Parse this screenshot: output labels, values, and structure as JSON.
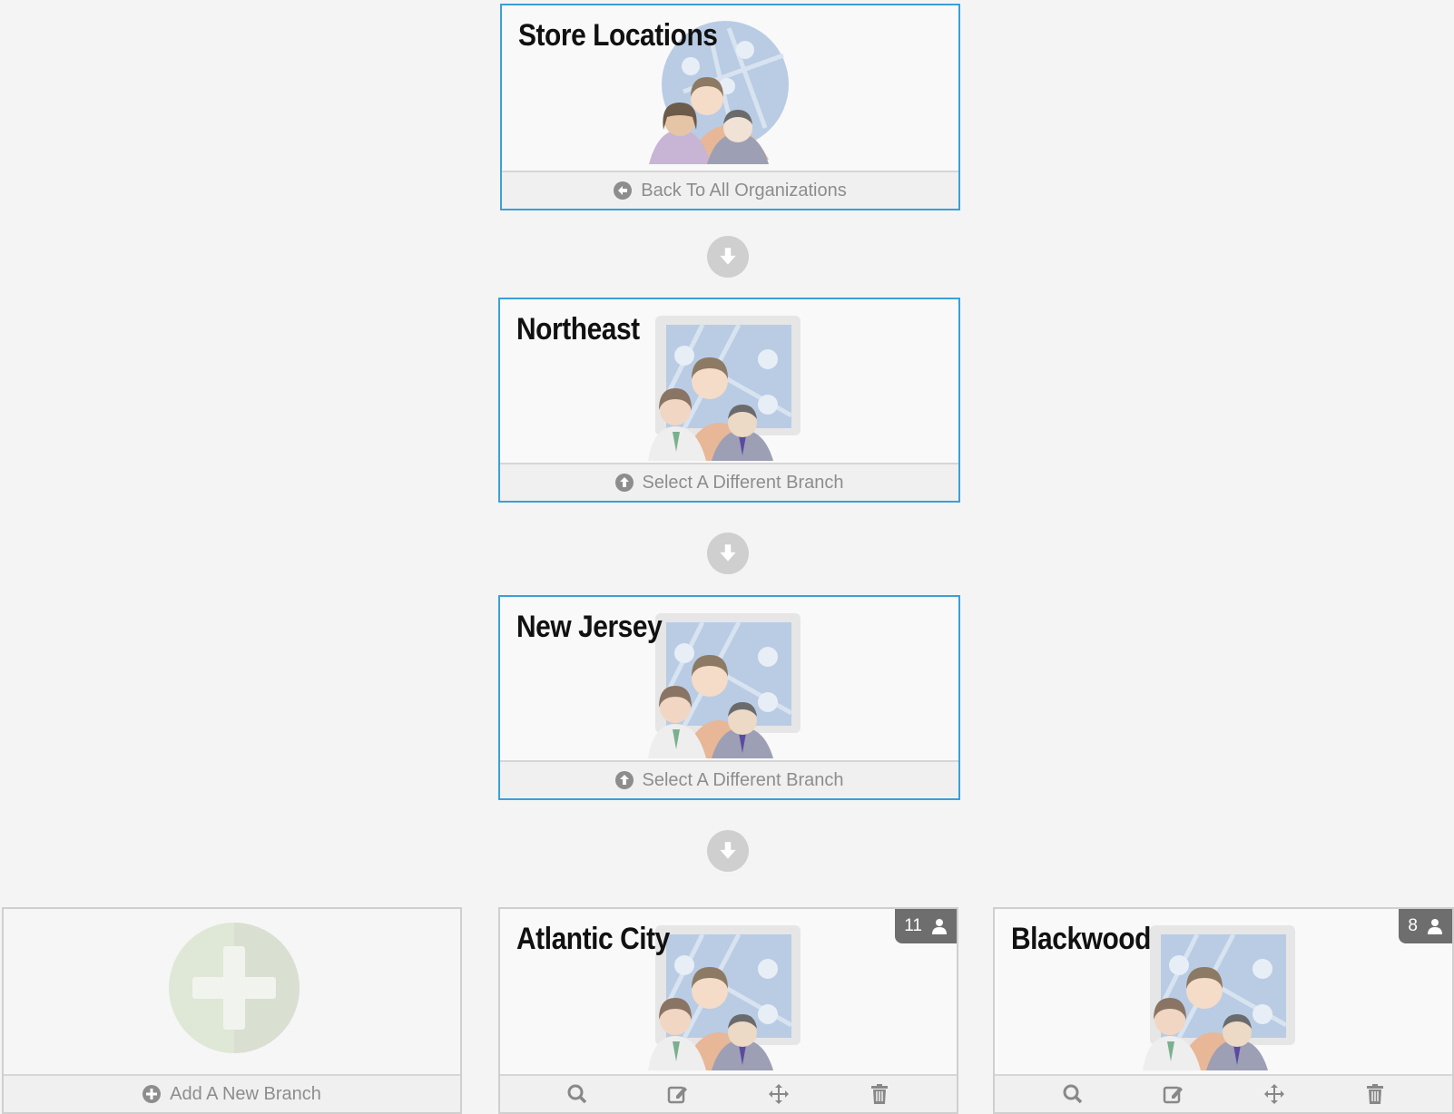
{
  "hierarchy": [
    {
      "title": "Store Locations",
      "footer": "Back To All Organizations",
      "footer_icon": "circle-arrow-left-icon"
    },
    {
      "title": "Northeast",
      "footer": "Select A Different Branch",
      "footer_icon": "circle-arrow-up-icon"
    },
    {
      "title": "New Jersey",
      "footer": "Select A Different Branch",
      "footer_icon": "circle-arrow-up-icon"
    }
  ],
  "add_branch": {
    "label": "Add A New Branch",
    "icon": "plus-circle-icon"
  },
  "branches": [
    {
      "title": "Atlantic City",
      "count": "11"
    },
    {
      "title": "Blackwood",
      "count": "8"
    }
  ],
  "colors": {
    "accent_border": "#3aa0d8",
    "badge": "#6e6e6e",
    "connector": "#cfcfcf"
  },
  "tools": [
    "search-icon",
    "edit-icon",
    "move-icon",
    "trash-icon"
  ]
}
